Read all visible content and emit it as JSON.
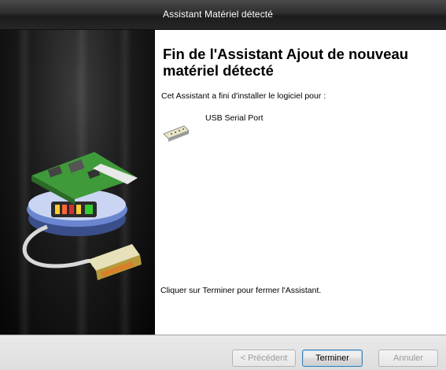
{
  "window": {
    "title": "Assistant Matériel détecté"
  },
  "content": {
    "heading": "Fin de l'Assistant Ajout de nouveau matériel détecté",
    "subtext": "Cet Assistant a fini d'installer le logiciel pour :",
    "device": {
      "icon": "serial-port-icon",
      "name": "USB Serial Port"
    },
    "finish_hint": "Cliquer sur Terminer pour fermer l'Assistant."
  },
  "buttons": {
    "previous": "< Précédent",
    "finish": "Terminer",
    "cancel": "Annuler"
  },
  "side_panel": {
    "illustration": "hardware-wizard-illustration"
  },
  "colors": {
    "titlebar": "#262626",
    "side_panel": "#141414",
    "button_bar": "#e3e3e3",
    "primary_button_border": "#3c7fb1"
  }
}
